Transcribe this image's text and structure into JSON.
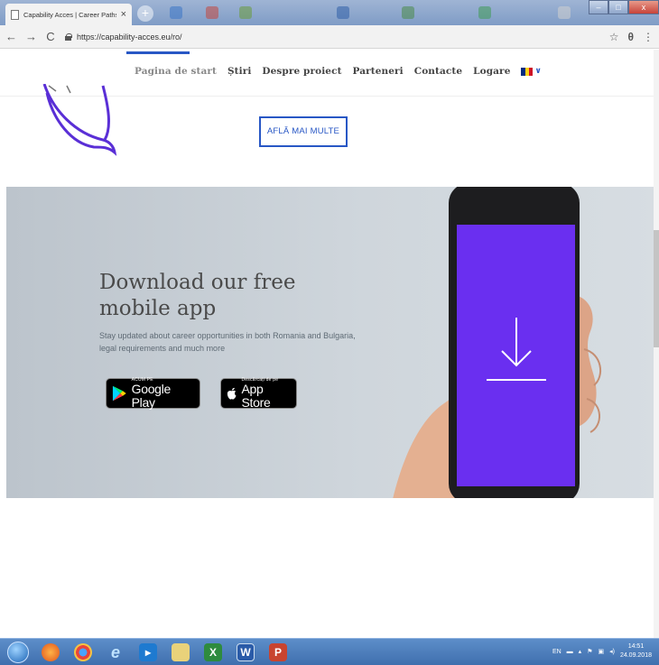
{
  "browser": {
    "tab_title": "Capability Acces | Career Paths t...",
    "tab_close": "×",
    "new_tab": "+",
    "back": "←",
    "forward": "→",
    "reload": "C",
    "url": "https://capability-acces.eu/ro/",
    "star": "☆",
    "profile": "θ",
    "menu": "⋮"
  },
  "nav": {
    "items": [
      "Pagina de start",
      "Știri",
      "Despre proiect",
      "Parteneri",
      "Contacte",
      "Logare"
    ],
    "lang_caret": "∨",
    "flag_colors": [
      "#002B7F",
      "#FCD116",
      "#CE1126"
    ]
  },
  "hero": {
    "cta_label": "AFLĂ MAI MULTE"
  },
  "app_promo": {
    "title_line1": "Download our free",
    "title_line2": "mobile app",
    "description": "Stay updated about career opportunities in both Romania and Bulgaria, legal requirements and much more",
    "google_play": {
      "small": "ACUM PE",
      "big": "Google Play"
    },
    "app_store": {
      "small": "Descărcați de pe",
      "big": "App Store"
    }
  },
  "taskbar": {
    "tray_lang": "EN",
    "time": "14:51",
    "date": "24.09.2018"
  },
  "colors": {
    "accent": "#2857c5",
    "phone_screen": "#6a2ff0"
  }
}
